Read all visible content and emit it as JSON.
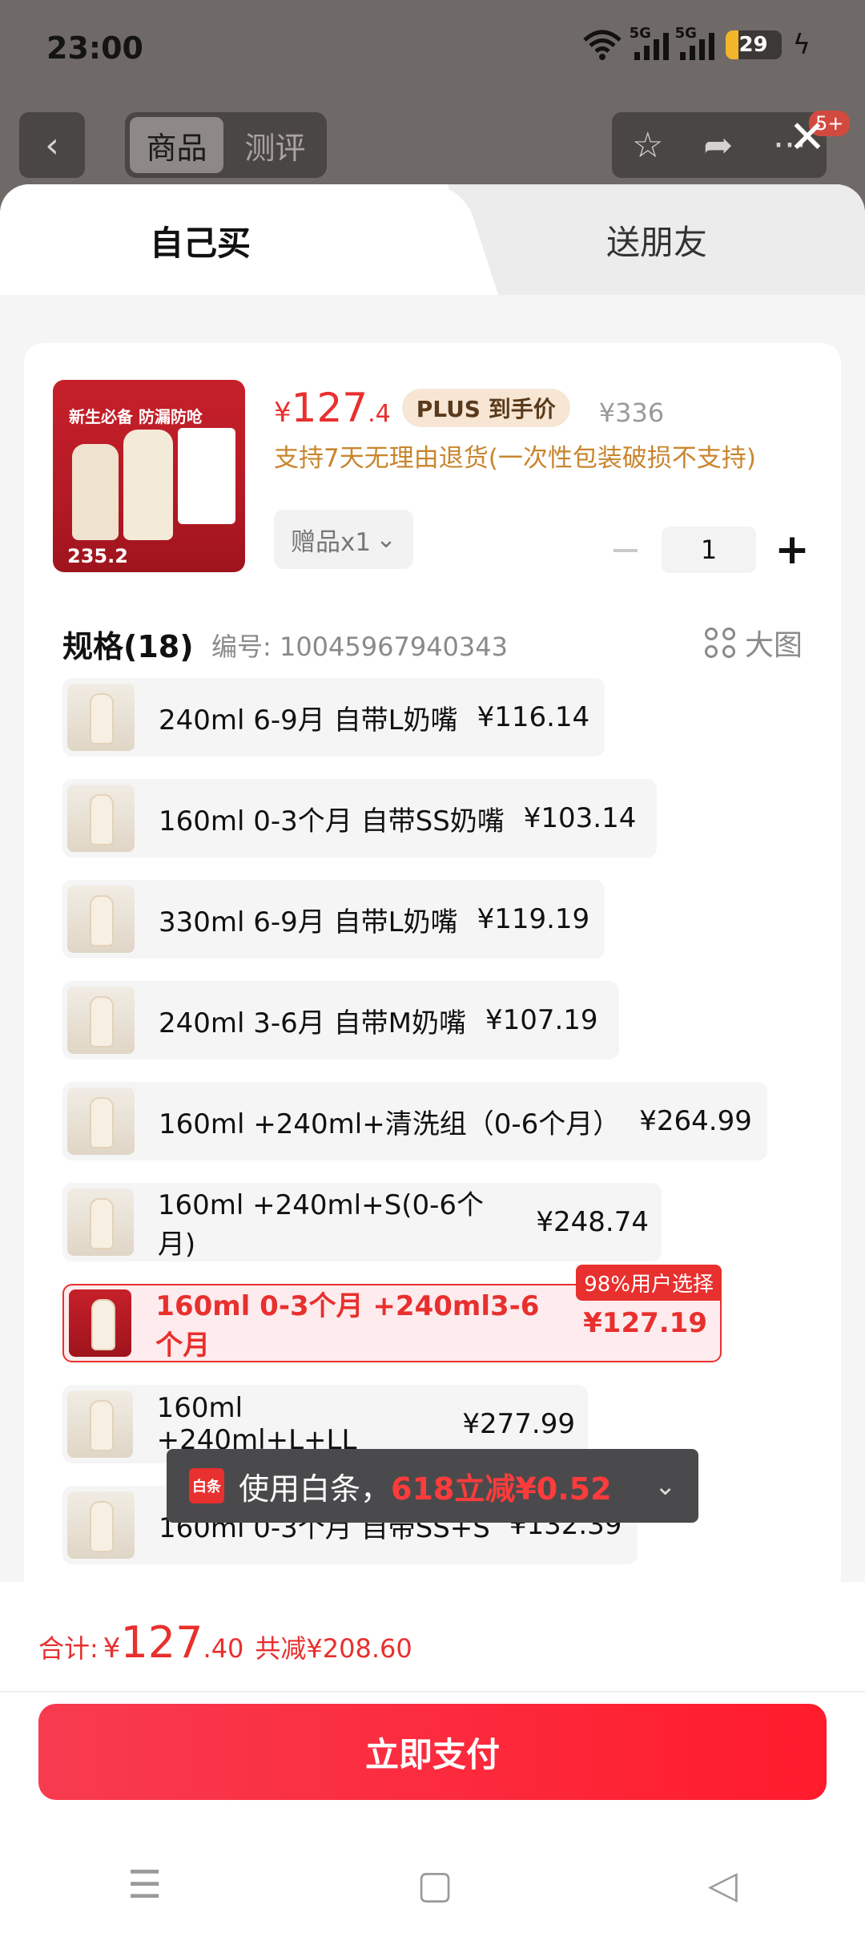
{
  "status": {
    "time": "23:00",
    "net1": "5G",
    "net2": "5G",
    "battery": "29"
  },
  "nav": {
    "back_icon": "‹",
    "tabs": [
      "商品",
      "测评"
    ],
    "star_icon": "☆",
    "share_icon": "➦",
    "more_icon": "···",
    "badge": "5+",
    "close_icon": "✕"
  },
  "sheet_tabs": {
    "self": "自己买",
    "gift": "送朋友"
  },
  "product": {
    "image_price": "235.2",
    "image_text": "新生必备 防漏防呛",
    "price_currency": "¥",
    "price_int": "127",
    "price_dec": ".4",
    "plus_tag": "PLUS 到手价",
    "original_price": "¥336",
    "return_note": "支持7天无理由退货(一次性包装破损不支持)",
    "gift_label": "赠品x1",
    "gift_chevron": "⌄",
    "quantity": "1",
    "minus": "−",
    "plus": "+"
  },
  "specs": {
    "title": "规格(18)",
    "code": "编号: 10045967940343",
    "big_image": "大图",
    "options": [
      {
        "label": "240ml 6-9月 自带L奶嘴",
        "price": "¥116.14"
      },
      {
        "label": "160ml 0-3个月 自带SS奶嘴",
        "price": "¥103.14"
      },
      {
        "label": "330ml 6-9月 自带L奶嘴",
        "price": "¥119.19"
      },
      {
        "label": "240ml 3-6月 自带M奶嘴",
        "price": "¥107.19"
      },
      {
        "label": "160ml +240ml+清洗组（0-6个月）",
        "price": "¥264.99"
      },
      {
        "label": "160ml +240ml+S(0-6个月)",
        "price": "¥248.74"
      },
      {
        "label": "160ml 0-3个月 +240ml3-6个月",
        "price": "¥127.19",
        "badge": "98%用户选择"
      },
      {
        "label": "160ml +240ml+L+LL",
        "price": "¥277.99"
      },
      {
        "label": "160ml 0-3个月 自带SS+S",
        "price": "¥132.39"
      }
    ]
  },
  "toast": {
    "icon_text": "白条",
    "text": "使用白条，",
    "highlight": "618立减¥0.52",
    "chevron": "⌄"
  },
  "footer": {
    "total_label": "合计:",
    "total_currency": "¥",
    "total_int": "127",
    "total_dec": ".40",
    "total_saving": "共减¥208.60",
    "pay_button": "立即支付"
  },
  "system_nav": {
    "menu_icon": "☰",
    "home_icon": "▢",
    "back_icon": "◁"
  },
  "colors": {
    "accent": "#e8302e",
    "gold": "#c9852e",
    "selected_bg": "#fdebed"
  }
}
